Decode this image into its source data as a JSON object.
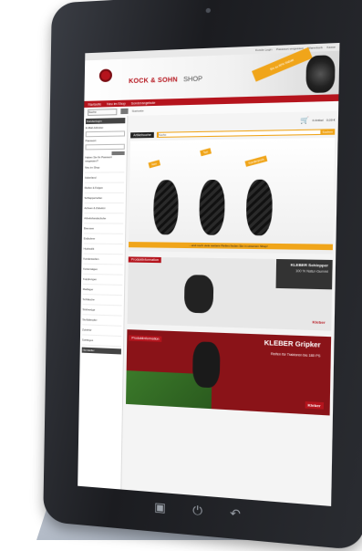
{
  "page": {
    "accent": "#b5141d",
    "accent_orange": "#f0a51a"
  },
  "site": {
    "topbar": [
      "Kunde Login",
      "Passwort vergessen",
      "Warenkorb",
      "Kasse"
    ],
    "logo": {
      "name": "KOCK & SOHN",
      "suffix": "SHOP"
    },
    "banner_ribbon": "Bis zu 60% Rabatt",
    "nav": [
      "Startseite",
      "Neu im Shop",
      "Sonderangebote"
    ],
    "crumbs": {
      "select": "Suche",
      "text": "Startseite"
    },
    "sidebar": {
      "header": "Kundenlogin",
      "email_label": "E-Mail-Adresse:",
      "password_label": "Passwort:",
      "login_button": "Anmelden",
      "note": "Haben Sie Ihr Passwort vergessen?",
      "items": [
        "Neu im Shop",
        "Ackerland",
        "Reifen & Felgen",
        "Schlepperreifen",
        "Achsen & Zubehör",
        "Arbeitshandschuhe",
        "Bremsen",
        "Erdbohrer",
        "Hydraulik",
        "Kardanwellen",
        "Kettensägen",
        "Kupplungen",
        "Radlager",
        "Schläuche",
        "Sitzbezüge",
        "Stoßdämpfer",
        "Zubehör",
        "Sonstiges"
      ],
      "footer": "Hersteller"
    },
    "cart": {
      "icon": "cart-icon",
      "text": "0 Artikel",
      "sum": "0,00 €"
    },
    "search": {
      "tag": "Artikelsuche",
      "placeholder": "Suche",
      "button": "Suchen"
    },
    "hero": {
      "labels": [
        "Neu",
        "Top",
        "Sonderpreis"
      ],
      "strip": "...und noch viele weitere Reifen finden Sie in unserem Shop!"
    },
    "info1": {
      "header": "Produktinformation",
      "title": "KLEBER Schlepper",
      "subtitle": "100 % Natur-Gummi",
      "brand": "Kleber"
    },
    "info2": {
      "header": "Produktinformation",
      "title": "KLEBER Gripker",
      "subtitle": "Reifen für Traktoren bis 180 PS",
      "brand": "Kleber"
    },
    "hw_buttons": [
      "home-button-icon",
      "power-icon",
      "back-icon"
    ]
  }
}
